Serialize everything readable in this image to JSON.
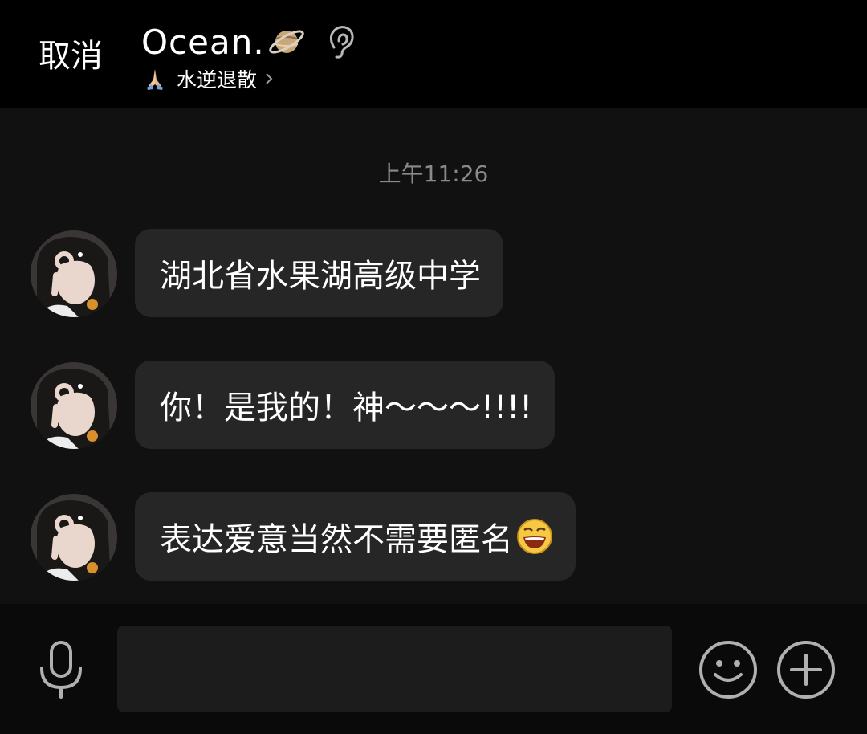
{
  "header": {
    "cancel_label": "取消",
    "title": "Ocean.",
    "title_icon": "planet-icon",
    "mode_icon": "ear-icon",
    "subtitle_icon": "pray-icon",
    "subtitle": "水逆退散"
  },
  "chat": {
    "timestamp": "上午11:26",
    "messages": [
      {
        "text": "湖北省水果湖高级中学",
        "avatar": "user-avatar"
      },
      {
        "text": "你！是我的！神～～～!!!!",
        "avatar": "user-avatar"
      },
      {
        "text": "表达爱意当然不需要匿名",
        "avatar": "user-avatar",
        "trailing_emoji": "laughing-emoji"
      }
    ]
  },
  "input_bar": {
    "voice_icon": "microphone-icon",
    "input_value": "",
    "emoji_icon": "smiley-icon",
    "more_icon": "plus-icon"
  },
  "colors": {
    "header_bg": "#000000",
    "chat_bg": "#111111",
    "bubble_bg": "#262626",
    "input_bar_bg": "#0a0a0a",
    "timestamp": "#8a8a8a",
    "icon_gray": "#b0b0b0"
  }
}
